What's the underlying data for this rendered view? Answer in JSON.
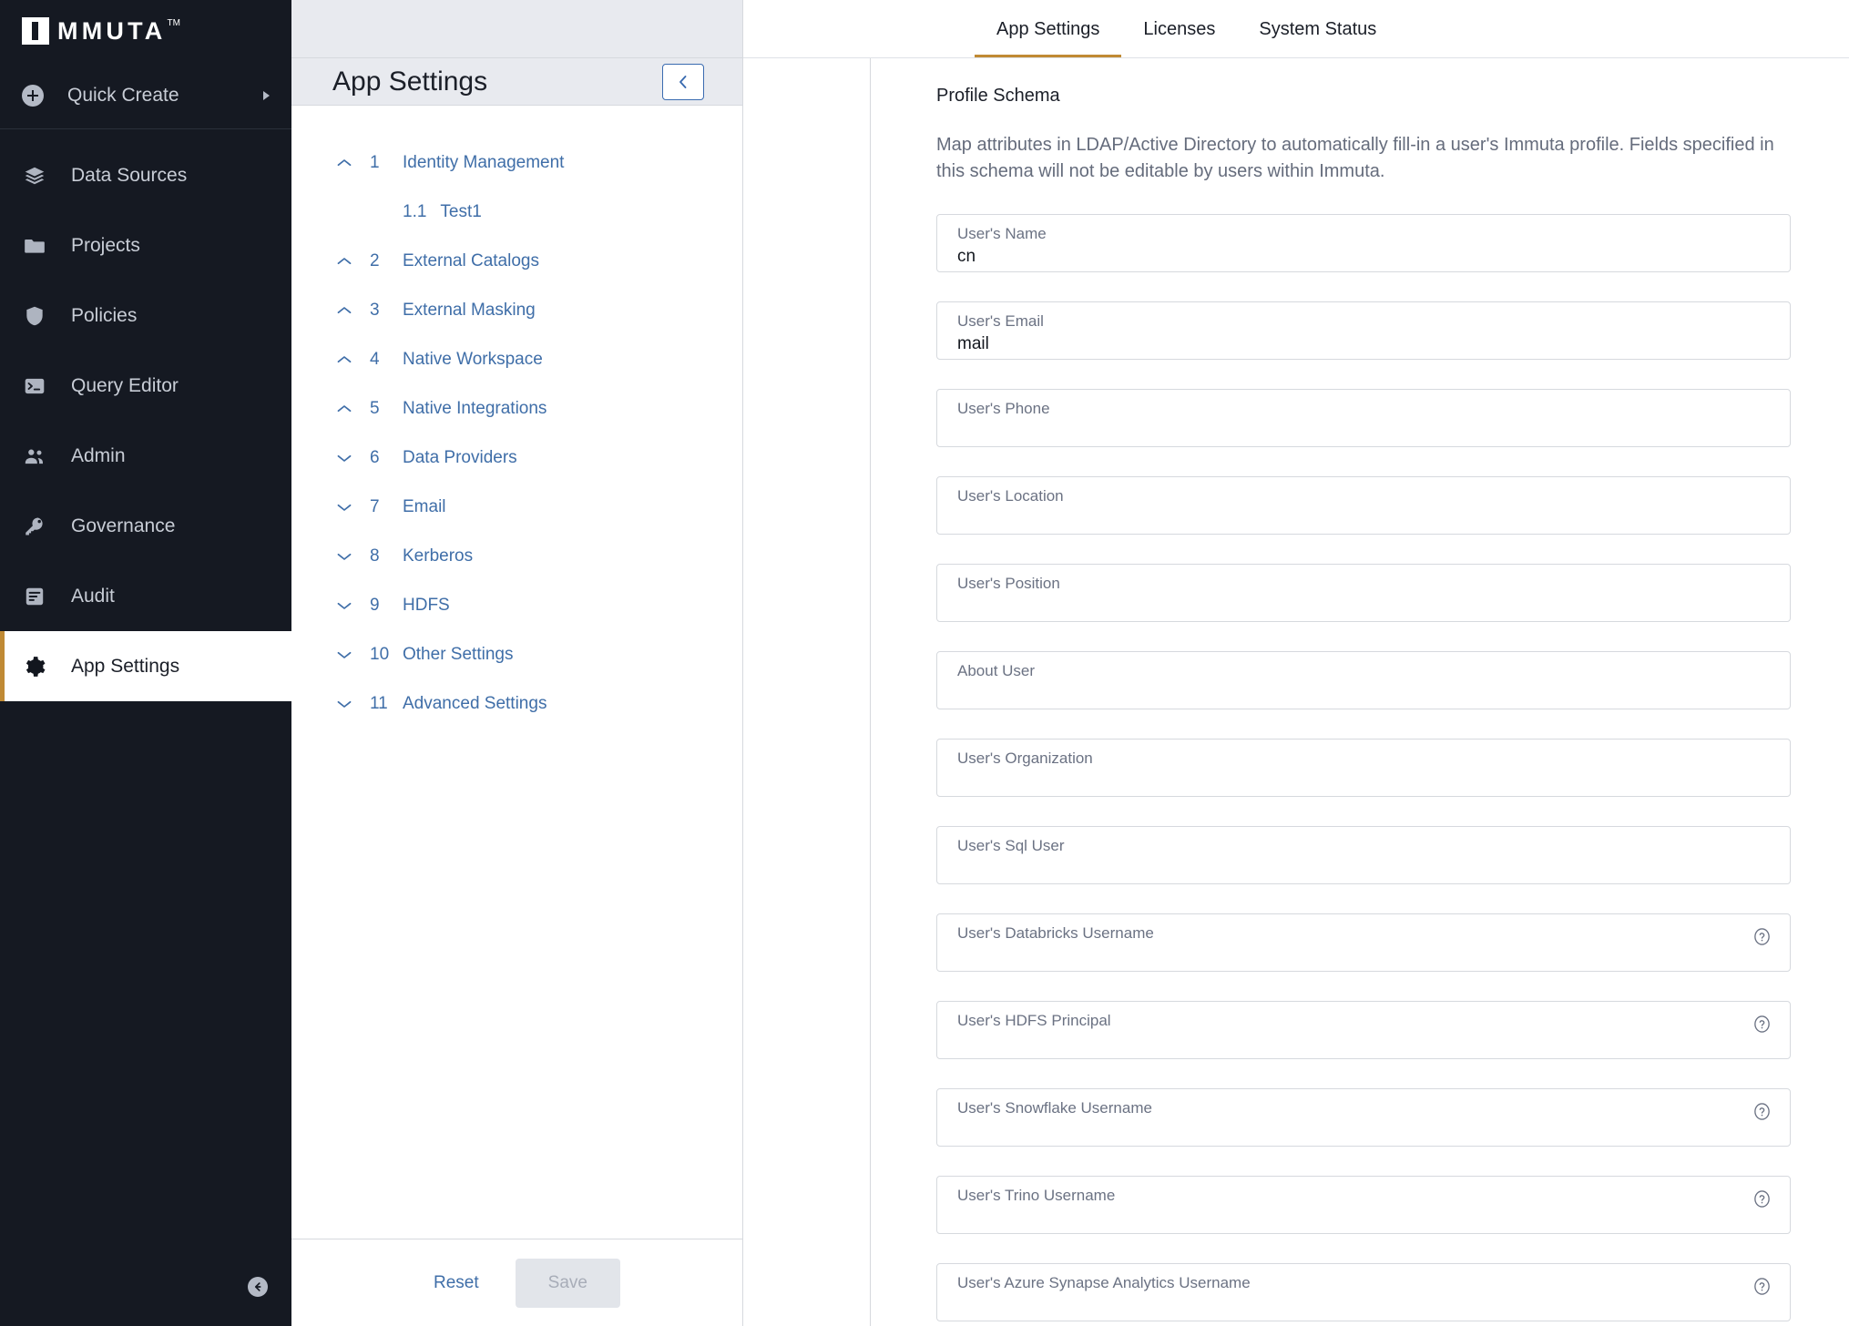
{
  "brand": {
    "name": "MMUTA",
    "trademark": "TM",
    "accent_color": "#c08a34",
    "sidebar_bg": "#151922",
    "link_color": "#3f6ea8"
  },
  "sidebar": {
    "quick_create": {
      "label": "Quick Create",
      "icon": "plus-circle-icon",
      "caret": "caret-right-icon"
    },
    "items": [
      {
        "label": "Data Sources",
        "icon": "layers-icon",
        "active": false
      },
      {
        "label": "Projects",
        "icon": "folder-icon",
        "active": false
      },
      {
        "label": "Policies",
        "icon": "shield-icon",
        "active": false
      },
      {
        "label": "Query Editor",
        "icon": "terminal-icon",
        "active": false
      },
      {
        "label": "Admin",
        "icon": "users-icon",
        "active": false
      },
      {
        "label": "Governance",
        "icon": "key-icon",
        "active": false
      },
      {
        "label": "Audit",
        "icon": "document-list-icon",
        "active": false
      },
      {
        "label": "App Settings",
        "icon": "gear-icon",
        "active": true
      }
    ],
    "collapse_button_icon": "arrow-left-circle-icon"
  },
  "settings_panel": {
    "title": "App Settings",
    "collapse_icon": "chevron-left-icon",
    "sections": [
      {
        "number": "1",
        "label": "Identity Management",
        "expanded": true,
        "subsections": [
          {
            "number": "1.1",
            "label": "Test1"
          }
        ]
      },
      {
        "number": "2",
        "label": "External Catalogs",
        "expanded": true,
        "subsections": []
      },
      {
        "number": "3",
        "label": "External Masking",
        "expanded": true,
        "subsections": []
      },
      {
        "number": "4",
        "label": "Native Workspace",
        "expanded": true,
        "subsections": []
      },
      {
        "number": "5",
        "label": "Native Integrations",
        "expanded": true,
        "subsections": []
      },
      {
        "number": "6",
        "label": "Data Providers",
        "expanded": false,
        "subsections": []
      },
      {
        "number": "7",
        "label": "Email",
        "expanded": false,
        "subsections": []
      },
      {
        "number": "8",
        "label": "Kerberos",
        "expanded": false,
        "subsections": []
      },
      {
        "number": "9",
        "label": "HDFS",
        "expanded": false,
        "subsections": []
      },
      {
        "number": "10",
        "label": "Other Settings",
        "expanded": false,
        "subsections": []
      },
      {
        "number": "11",
        "label": "Advanced Settings",
        "expanded": false,
        "subsections": []
      }
    ],
    "footer": {
      "reset_label": "Reset",
      "save_label": "Save",
      "save_disabled": true
    }
  },
  "top_tabs": [
    {
      "label": "App Settings",
      "active": true
    },
    {
      "label": "Licenses",
      "active": false
    },
    {
      "label": "System Status",
      "active": false
    }
  ],
  "main": {
    "section_title": "Profile Schema",
    "section_description": "Map attributes in LDAP/Active Directory to automatically fill-in a user's Immuta profile. Fields specified in this schema will not be editable by users within Immuta.",
    "fields": [
      {
        "label": "User's Name",
        "value": "cn",
        "help": false
      },
      {
        "label": "User's Email",
        "value": "mail",
        "help": false
      },
      {
        "label": "User's Phone",
        "value": "",
        "help": false
      },
      {
        "label": "User's Location",
        "value": "",
        "help": false
      },
      {
        "label": "User's Position",
        "value": "",
        "help": false
      },
      {
        "label": "About User",
        "value": "",
        "help": false
      },
      {
        "label": "User's Organization",
        "value": "",
        "help": false
      },
      {
        "label": "User's Sql User",
        "value": "",
        "help": false
      },
      {
        "label": "User's Databricks Username",
        "value": "",
        "help": true
      },
      {
        "label": "User's HDFS Principal",
        "value": "",
        "help": true
      },
      {
        "label": "User's Snowflake Username",
        "value": "",
        "help": true
      },
      {
        "label": "User's Trino Username",
        "value": "",
        "help": true
      },
      {
        "label": "User's Azure Synapse Analytics Username",
        "value": "",
        "help": true
      }
    ],
    "help_icon_name": "help-circle-icon"
  }
}
